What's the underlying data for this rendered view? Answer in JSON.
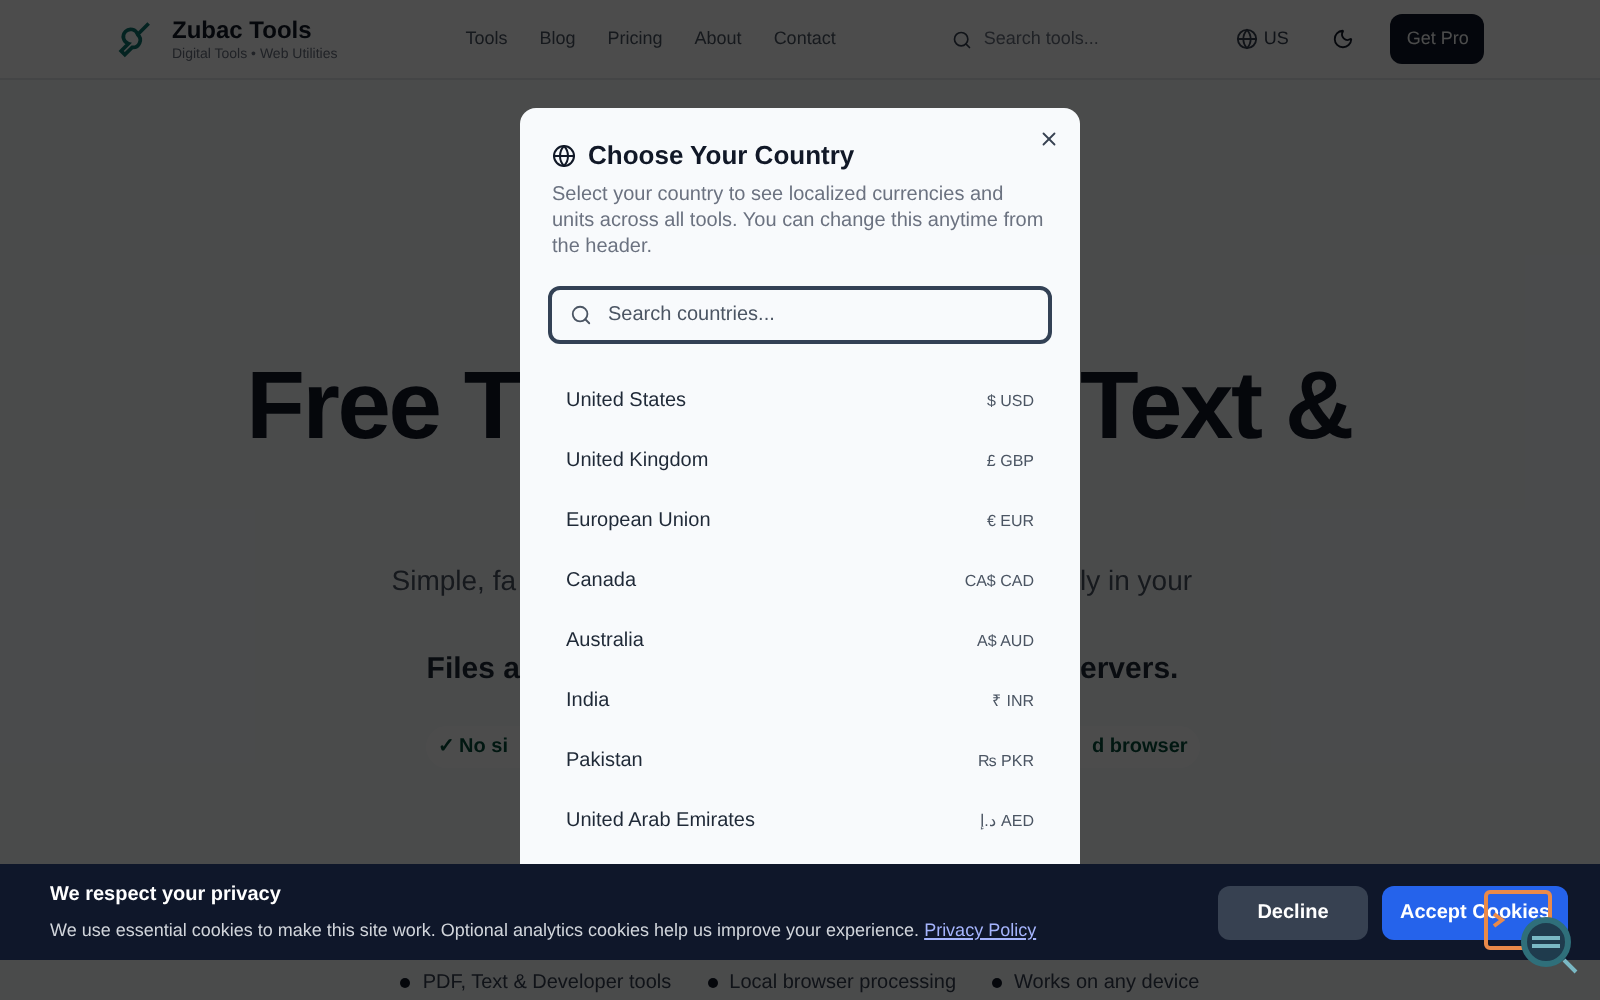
{
  "header": {
    "brand": "Zubac Tools",
    "tagline": "Digital Tools • Web Utilities",
    "nav": [
      "Tools",
      "Blog",
      "Pricing",
      "About",
      "Contact"
    ],
    "search": {
      "placeholder": "Search tools..."
    },
    "locale": "US",
    "cta": "Get Pro"
  },
  "hero": {
    "title_left": "Free T",
    "title_right": "Text &",
    "subtitle_left": "Simple, fa",
    "subtitle_right": "ly in your",
    "note_left": "Files a",
    "note_right": "ervers.",
    "chip_left": "✓ No si",
    "chip_right": "d browser",
    "features": [
      "PDF, Text & Developer tools",
      "Local browser processing",
      "Works on any device"
    ]
  },
  "dialog": {
    "title": "Choose Your Country",
    "description": "Select your country to see localized currencies and units across all tools. You can change this anytime from the header.",
    "search": {
      "placeholder": "Search countries..."
    },
    "countries": [
      {
        "name": "United States",
        "currency": "$ USD"
      },
      {
        "name": "United Kingdom",
        "currency": "£ GBP"
      },
      {
        "name": "European Union",
        "currency": "€ EUR"
      },
      {
        "name": "Canada",
        "currency": "CA$ CAD"
      },
      {
        "name": "Australia",
        "currency": "A$ AUD"
      },
      {
        "name": "India",
        "currency": "₹ INR"
      },
      {
        "name": "Pakistan",
        "currency": "₨ PKR"
      },
      {
        "name": "United Arab Emirates",
        "currency": "د.إ AED"
      }
    ]
  },
  "cookie_banner": {
    "title": "We respect your privacy",
    "text": "We use essential cookies to make this site work. Optional analytics cookies help us improve your experience.",
    "link": "Privacy Policy",
    "buttons": [
      "Decline",
      "Accept Cookies"
    ]
  }
}
